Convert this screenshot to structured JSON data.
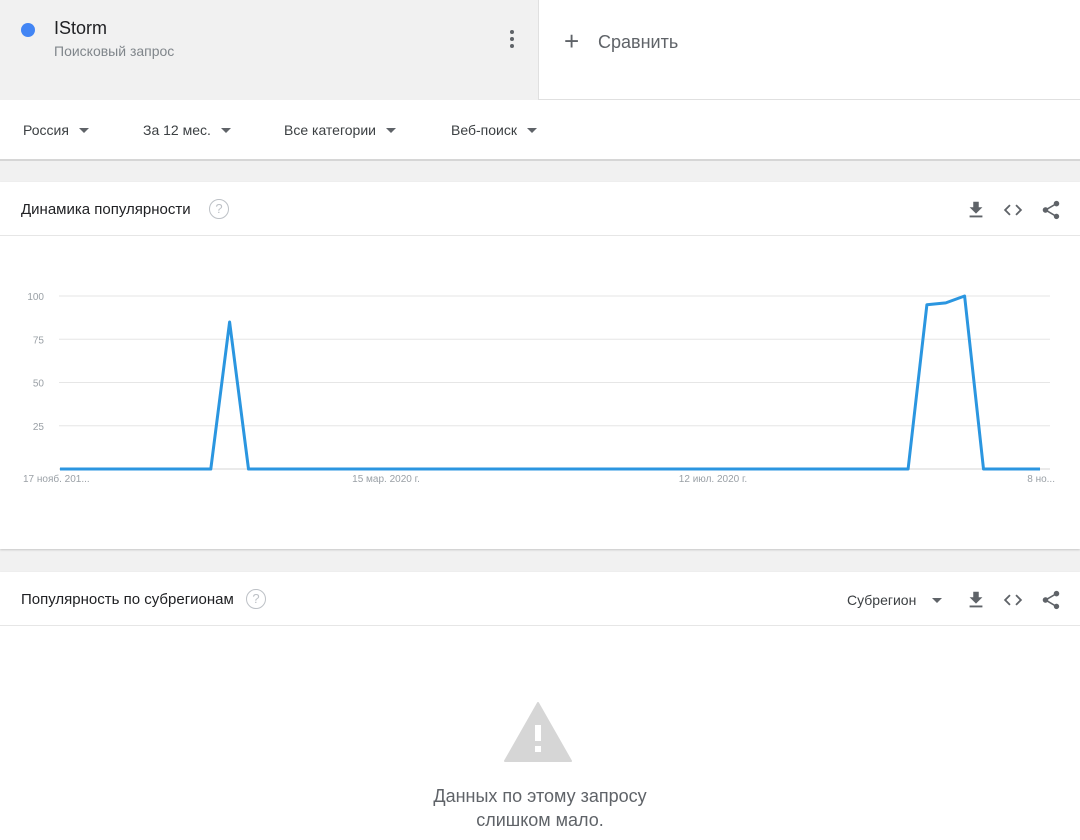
{
  "term": {
    "name": "IStorm",
    "subtitle": "Поисковый запрос",
    "color": "#4285f4"
  },
  "compare": {
    "label": "Сравнить"
  },
  "filters": [
    {
      "label": "Россия"
    },
    {
      "label": "За 12 мес."
    },
    {
      "label": "Все категории"
    },
    {
      "label": "Веб-поиск"
    }
  ],
  "trend_card": {
    "title": "Динамика популярности",
    "help": "?"
  },
  "chart_data": {
    "type": "line",
    "y_ticks": [
      100,
      75,
      50,
      25
    ],
    "ylim": [
      0,
      100
    ],
    "x_tick_labels": [
      "17 нояб. 201...",
      "15 мар. 2020 г.",
      "12 июл. 2020 г.",
      "8 но..."
    ],
    "line_color": "#2b96e0",
    "series": [
      {
        "values": [
          0,
          0,
          0,
          0,
          0,
          0,
          0,
          0,
          0,
          85,
          0,
          0,
          0,
          0,
          0,
          0,
          0,
          0,
          0,
          0,
          0,
          0,
          0,
          0,
          0,
          0,
          0,
          0,
          0,
          0,
          0,
          0,
          0,
          0,
          0,
          0,
          0,
          0,
          0,
          0,
          0,
          0,
          0,
          0,
          0,
          0,
          95,
          96,
          100,
          0,
          0,
          0,
          0
        ]
      }
    ]
  },
  "region_card": {
    "title": "Популярность по субрегионам",
    "help": "?",
    "dropdown": "Субрегион",
    "message_line1": "Данных по этому запросу",
    "message_line2": "слишком мало."
  }
}
